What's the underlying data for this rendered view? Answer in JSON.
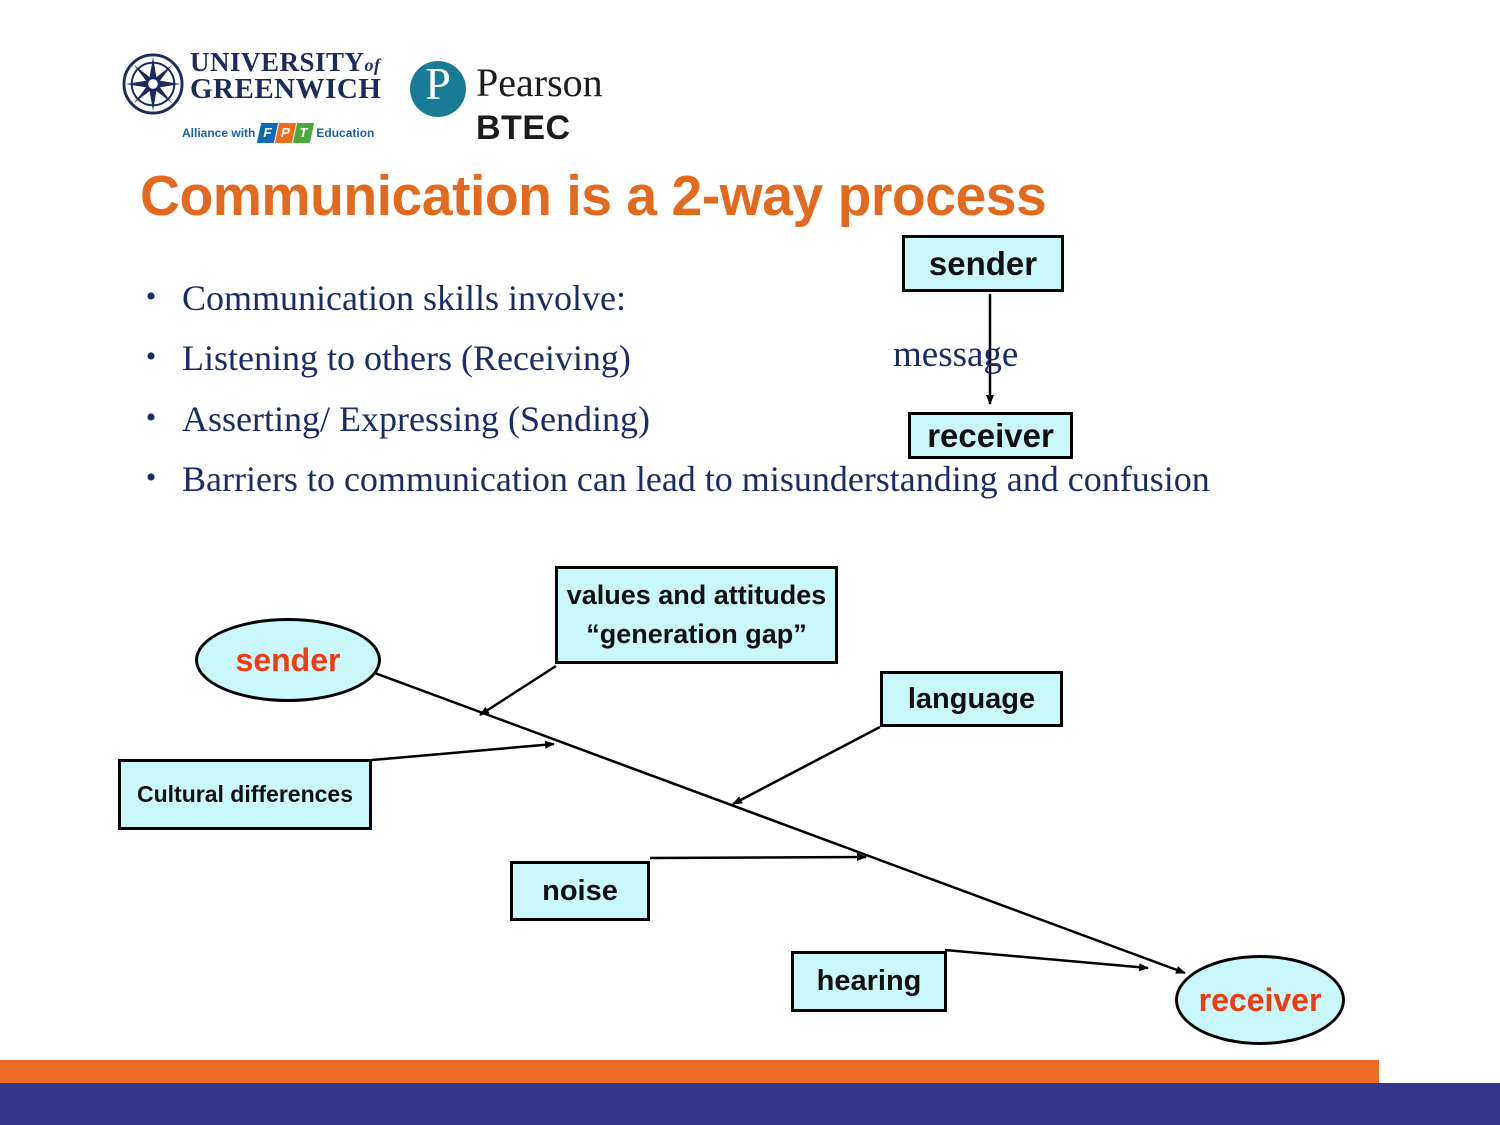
{
  "slide": {
    "title": "Communication is a 2-way process",
    "title_color": "#e2691d",
    "body_text_color": "#1c2b66",
    "node_fill": "#caf7f7",
    "node_accent_text": "#ef3b12",
    "footer_orange": "#ec6c24",
    "footer_navy": "#32358c"
  },
  "logos": {
    "university": {
      "line1": "UNIVERSITY",
      "line1_of": "of",
      "line2": "GREENWICH",
      "alliance_prefix": "Alliance with",
      "alliance_brand": [
        "F",
        "P",
        "T"
      ],
      "alliance_suffix": "Education",
      "compass_icon": "compass-rose-icon"
    },
    "pearson": {
      "mark_glyph": "P",
      "wordmark": "Pearson",
      "sub": "BTEC",
      "mark_icon": "pearson-interrobang-icon"
    }
  },
  "bullets": [
    {
      "marker": "•",
      "text": "Communication skills involve:"
    },
    {
      "marker": "•",
      "text": "Listening to others (Receiving)"
    },
    {
      "marker": "•",
      "text": "Asserting/ Expressing (Sending)"
    },
    {
      "marker": "•",
      "text": "Barriers to communication can lead to misunderstanding and confusion"
    }
  ],
  "top_diagram": {
    "sender_label": "sender",
    "receiver_label": "receiver",
    "message_label": "message",
    "arrow_icon": "down-arrow-icon"
  },
  "barrier_diagram": {
    "sender_label": "sender",
    "receiver_label": "receiver",
    "barriers": [
      {
        "label_line1": "values and attitudes",
        "label_line2": "“generation gap”"
      },
      {
        "label": "language"
      },
      {
        "label": "Cultural differences"
      },
      {
        "label": "noise"
      },
      {
        "label": "hearing"
      }
    ]
  }
}
